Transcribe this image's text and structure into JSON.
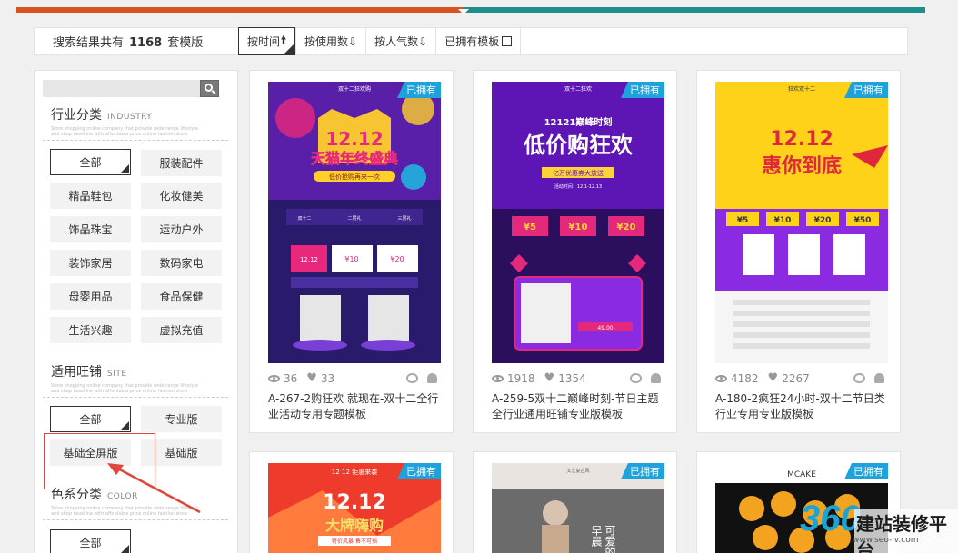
{
  "result_bar": {
    "prefix": "搜索结果共有",
    "count": "1168",
    "suffix": "套模版",
    "sorts": [
      {
        "label": "按时间",
        "arrow": "🠙"
      },
      {
        "label": "按使用数",
        "arrow": "⇩"
      },
      {
        "label": "按人气数",
        "arrow": "⇩"
      }
    ],
    "owned_filter": "已拥有模板"
  },
  "sidebar": {
    "search_placeholder": "",
    "industry": {
      "title": "行业分类",
      "en": "INDUSTRY",
      "sub": "Store shopping online company that provide wide range lifestyle and shop headline with affordable price online fashion store",
      "tags": [
        "全部",
        "服装配件",
        "精品鞋包",
        "化妆健美",
        "饰品珠宝",
        "运动户外",
        "装饰家居",
        "数码家电",
        "母婴用品",
        "食品保健",
        "生活兴趣",
        "虚拟充值"
      ]
    },
    "site": {
      "title": "适用旺铺",
      "en": "SITE",
      "sub": "Store shopping online company that provide wide range lifestyle and shop headline with affordable price online fashion store",
      "tags": [
        "全部",
        "专业版",
        "基础全屏版",
        "基础版"
      ]
    },
    "color": {
      "title": "色系分类",
      "en": "COLOR",
      "sub": "Store shopping online company that provide wide range lifestyle and shop headline with affordable price online fashion store",
      "tags": [
        "全部"
      ]
    }
  },
  "colors": {
    "accent_orange": "#d9531e",
    "accent_teal": "#1d8f8a",
    "badge_blue": "#1fa1db",
    "highlight_red": "#e0463c"
  },
  "cards": [
    {
      "badge": "已拥有",
      "views": "36",
      "likes": "33",
      "title": "A-267-2购狂欢 就现在-双十二全行业活动专用专题模板",
      "thumb": {
        "top_text": "双十二狂欢购",
        "big": "12.12",
        "headline": "天猫年终盛典",
        "sub": "低价抢购再来一次",
        "c1": "#5a1fa8",
        "c2": "#2a1a6b",
        "c3": "#e8287a",
        "c4": "#ffcf2a",
        "coupon_prefix": "¥",
        "coupons": [
          "12.12",
          "10",
          "20"
        ],
        "sections": [
          "双十二",
          "二层礼",
          "三层礼"
        ]
      }
    },
    {
      "badge": "已拥有",
      "views": "1918",
      "likes": "1354",
      "title": "A-259-5双十二巅峰时刻-节日主题全行业通用旺铺专业版模板",
      "thumb": {
        "top_text": "双十二狂欢",
        "big": "12121巅峰时刻",
        "headline": "低价购狂欢",
        "sub": "亿万优惠券大放送",
        "date": "活动时间：12.1-12.13",
        "c1": "#5d16b5",
        "c2": "#2b0f5e",
        "c3": "#e4287c",
        "c4": "#ffd23a",
        "coupon_prefix": "¥",
        "coupons": [
          "5",
          "10",
          "20"
        ],
        "price": "49.00"
      }
    },
    {
      "badge": "已拥有",
      "views": "4182",
      "likes": "2267",
      "title": "A-180-2疯狂24小时-双十二节日类行业专用专业版模板",
      "thumb": {
        "top_text": "狂欢双十二",
        "big": "12.12",
        "headline": "惠你到底",
        "c1": "#ffd21a",
        "c2": "#8a2be2",
        "c3": "#e0263c",
        "c4": "#ffffff",
        "coupon_prefix": "¥",
        "coupons": [
          "5",
          "10",
          "20",
          "50"
        ]
      }
    },
    {
      "badge": "已拥有",
      "thumb": {
        "top_text": "12 12 钜惠来袭",
        "big": "12.12",
        "headline": "大牌嗨购",
        "sub": "特价风暴 售不可挡",
        "c1": "#ef3b2c",
        "c2": "#ff7a3d"
      }
    },
    {
      "badge": "已拥有",
      "thumb": {
        "top_text": "文艺复古风",
        "headline": "可爱的",
        "sub": "早晨",
        "c1": "#e9e4df",
        "c2": "#6b6b6b"
      }
    },
    {
      "badge": "已拥有",
      "thumb": {
        "top_text": "MCAKE",
        "c1": "#ffffff",
        "c2": "#111111",
        "c3": "#f4a320"
      }
    }
  ],
  "watermark": {
    "num": "360",
    "text": "建站装修平台",
    "url": "www.seo-lv.com"
  }
}
